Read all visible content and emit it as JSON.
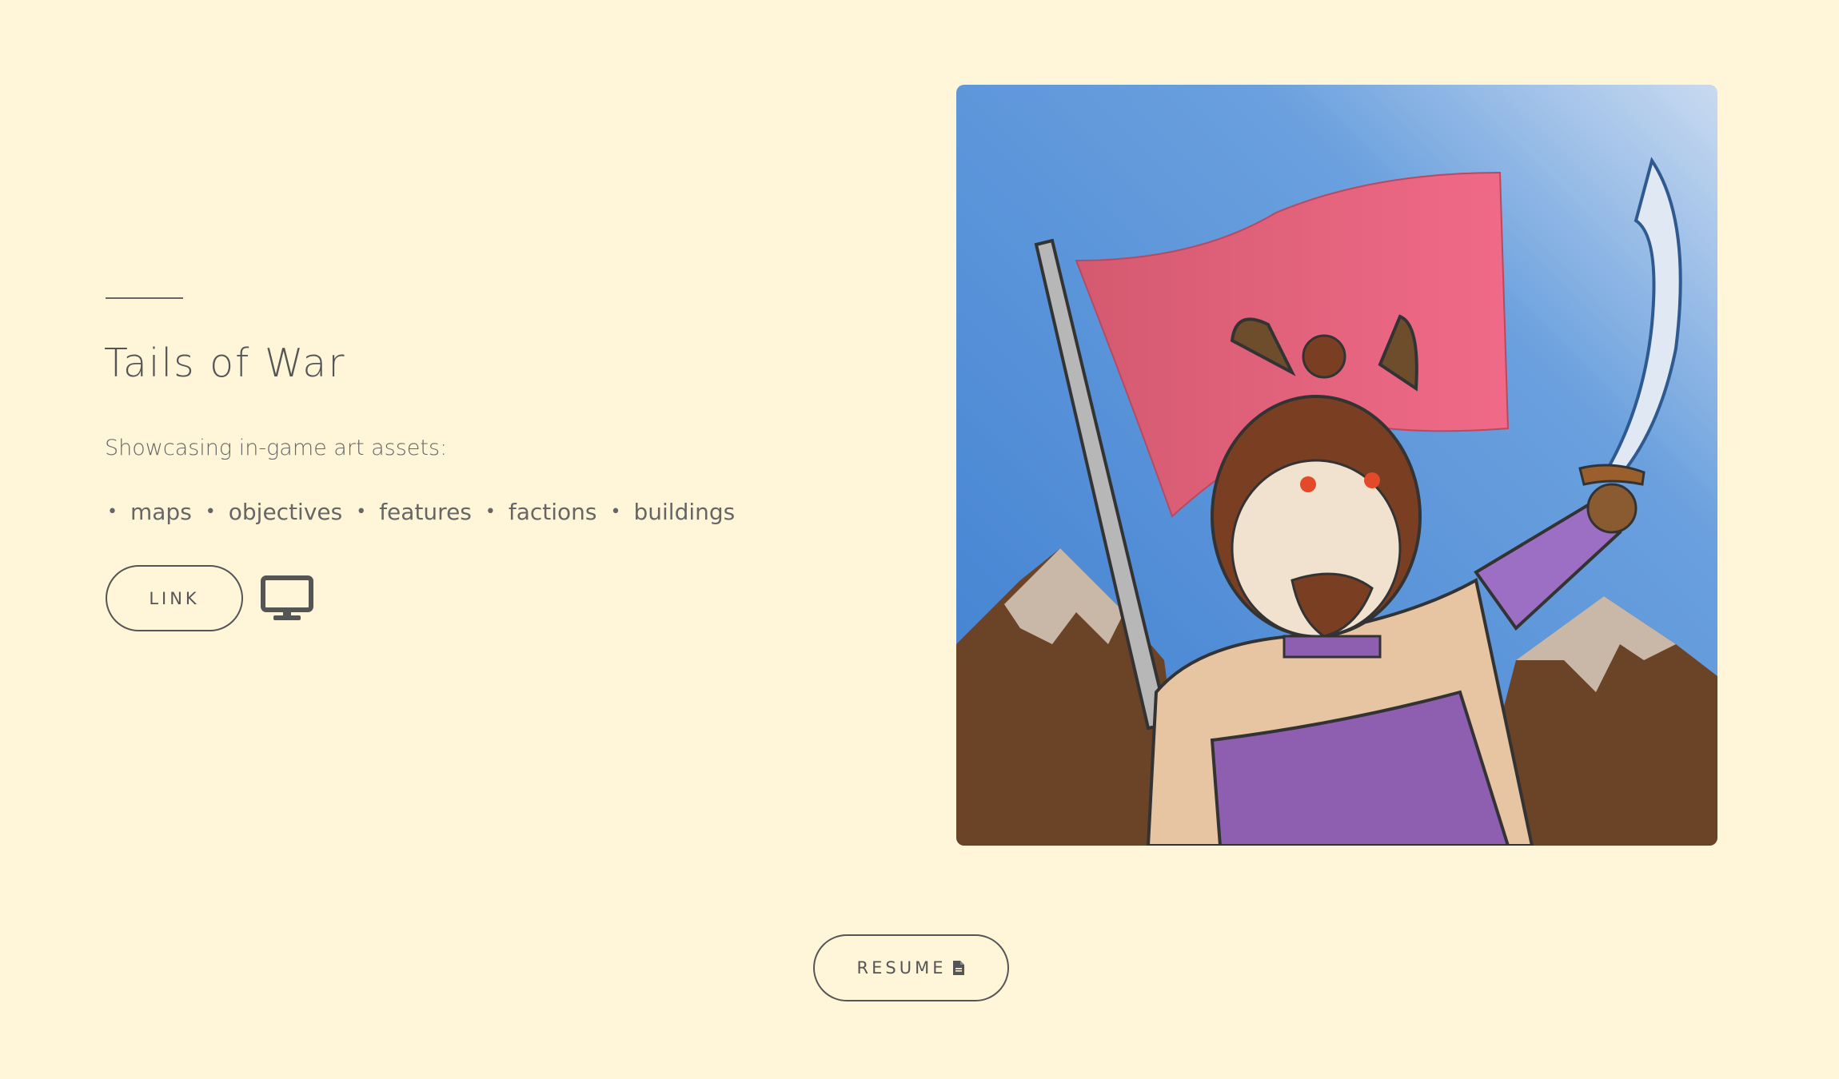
{
  "project": {
    "title": "Tails of War",
    "description": "Showcasing in-game art assets:",
    "tags": [
      "maps",
      "objectives",
      "features",
      "factions",
      "buildings"
    ],
    "link_label": "LINK",
    "platform_icon": "desktop-monitor-icon",
    "artwork": "fox-warrior-with-flag-and-sword-illustration"
  },
  "footer": {
    "resume_label": "RESUME",
    "resume_icon": "document-icon"
  },
  "colors": {
    "background": "#fff6d9",
    "text": "#555555",
    "sky": "#5a95dc",
    "flag": "#e5607a",
    "armor": "#8e5fb0",
    "mountain": "#6b4428"
  }
}
